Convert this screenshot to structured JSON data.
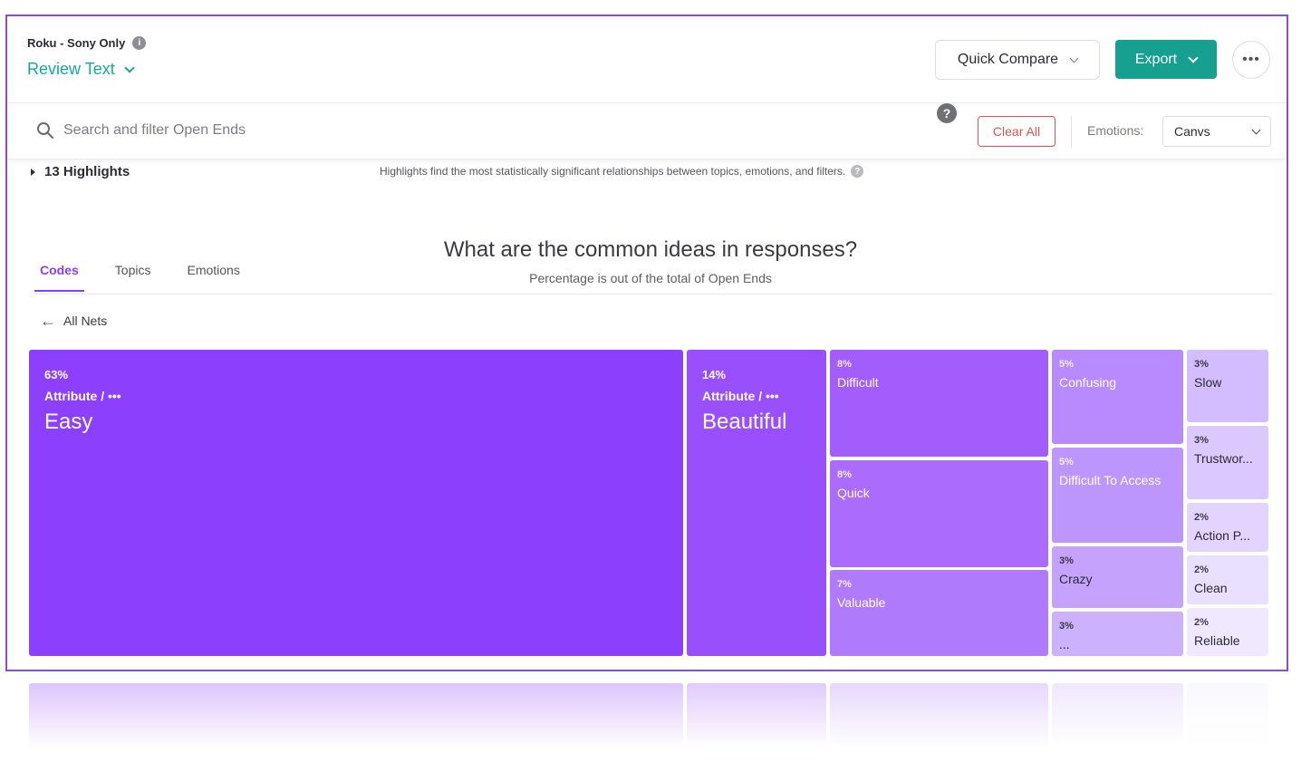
{
  "header": {
    "project_name": "Roku - Sony Only",
    "info_icon": "info-icon",
    "view_label": "Review Text",
    "quick_compare_label": "Quick Compare",
    "export_label": "Export",
    "more_label": "•••"
  },
  "search": {
    "placeholder": "Search and filter Open Ends",
    "value": "",
    "help_label": "?",
    "clear_all_label": "Clear All",
    "emotions_label": "Emotions:",
    "emotions_value": "Canvs"
  },
  "highlights": {
    "label": "13 Highlights",
    "note": "Highlights find the most statistically significant relationships between topics, emotions, and filters."
  },
  "chart": {
    "title": "What are the common ideas in responses?",
    "subtitle": "Percentage is out of the total of Open Ends",
    "tabs": [
      {
        "label": "Codes",
        "active": true
      },
      {
        "label": "Topics",
        "active": false
      },
      {
        "label": "Emotions",
        "active": false
      }
    ],
    "back_label": "All Nets"
  },
  "colors": {
    "accent": "#8a3ffc",
    "teal": "#15a090",
    "danger": "#e05151"
  },
  "chart_data": {
    "type": "treemap",
    "unit": "%",
    "items": [
      {
        "label": "Easy",
        "value": 63,
        "category": "Attribute / •••"
      },
      {
        "label": "Beautiful",
        "value": 14,
        "category": "Attribute / •••"
      },
      {
        "label": "Difficult",
        "value": 8
      },
      {
        "label": "Quick",
        "value": 8
      },
      {
        "label": "Valuable",
        "value": 7
      },
      {
        "label": "Confusing",
        "value": 5
      },
      {
        "label": "Difficult To Access",
        "value": 5
      },
      {
        "label": "Crazy",
        "value": 3
      },
      {
        "label": "...",
        "value": 3
      },
      {
        "label": "Slow",
        "value": 3
      },
      {
        "label": "Trustwor...",
        "value": 3
      },
      {
        "label": "Action P...",
        "value": 2
      },
      {
        "label": "Clean",
        "value": 2
      },
      {
        "label": "Reliable",
        "value": 2
      }
    ]
  }
}
